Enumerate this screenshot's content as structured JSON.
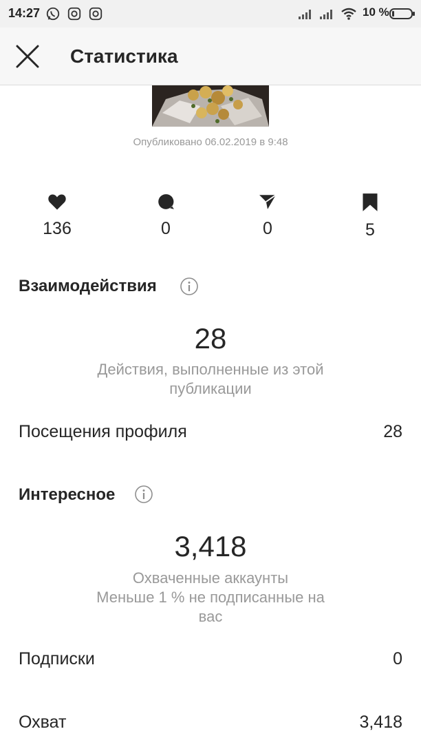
{
  "status_bar": {
    "time": "14:27",
    "battery": "10 %",
    "app_icons": [
      "whatsapp-icon",
      "instagram-icon",
      "instagram-icon"
    ]
  },
  "header": {
    "title": "Статистика",
    "close_icon": "close-icon"
  },
  "post": {
    "published": "Опубликовано 06.02.2019 в 9:48"
  },
  "stats": [
    {
      "icon": "heart-icon",
      "value": "136"
    },
    {
      "icon": "comment-icon",
      "value": "0"
    },
    {
      "icon": "share-icon",
      "value": "0"
    },
    {
      "icon": "bookmark-icon",
      "value": "5"
    }
  ],
  "interactions": {
    "title": "Взаимодействия",
    "value": "28",
    "caption": "Действия, выполненные из этой публикации",
    "rows": [
      {
        "label": "Посещения профиля",
        "value": "28"
      }
    ]
  },
  "discovery": {
    "title": "Интересное",
    "value": "3,418",
    "caption_line1": "Охваченные аккаунты",
    "caption_line2": "Меньше 1 % не подписанные на вас",
    "rows": [
      {
        "label": "Подписки",
        "value": "0"
      },
      {
        "label": "Охват",
        "value": "3,418"
      }
    ]
  },
  "colors": {
    "text": "#262626",
    "muted": "#999999",
    "status_bar_bg": "#f1f1f1",
    "header_bg": "#f7f7f7"
  }
}
